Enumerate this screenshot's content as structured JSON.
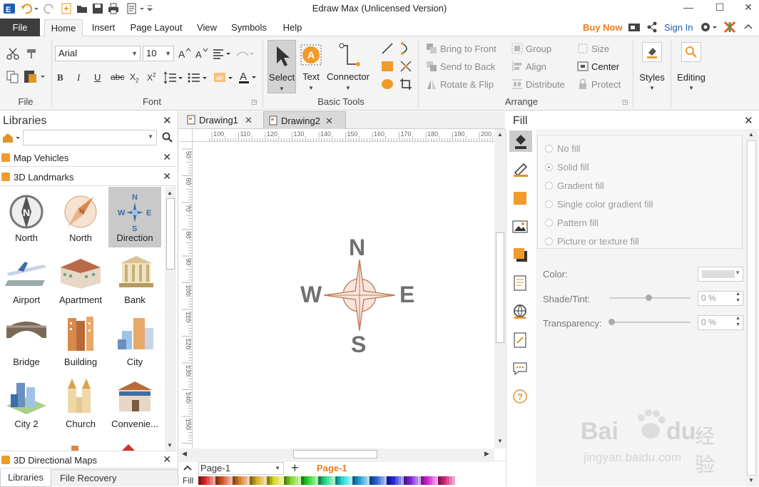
{
  "window": {
    "title": "Edraw Max (Unlicensed Version)"
  },
  "ribbon_tabs": {
    "file": "File",
    "tabs": [
      "Home",
      "Insert",
      "Page Layout",
      "View",
      "Symbols",
      "Help"
    ],
    "active": "Home",
    "buy_now": "Buy Now",
    "sign_in": "Sign In"
  },
  "ribbon": {
    "groups": {
      "file": "File",
      "font": "Font",
      "basic_tools": "Basic Tools",
      "arrange": "Arrange"
    },
    "font_name": "Arial",
    "font_size": "10",
    "tools": {
      "select": "Select",
      "text": "Text",
      "connector": "Connector"
    },
    "arrange": {
      "bring_to_front": "Bring to Front",
      "send_to_back": "Send to Back",
      "rotate_flip": "Rotate & Flip",
      "group": "Group",
      "align": "Align",
      "distribute": "Distribute",
      "size": "Size",
      "center": "Center",
      "protect": "Protect"
    },
    "styles": "Styles",
    "editing": "Editing"
  },
  "libraries": {
    "title": "Libraries",
    "search_value": "",
    "sections": [
      "Map Vehicles",
      "3D Landmarks"
    ],
    "shapes": [
      {
        "label": "North"
      },
      {
        "label": "North"
      },
      {
        "label": "Direction"
      },
      {
        "label": "Airport"
      },
      {
        "label": "Apartment"
      },
      {
        "label": "Bank"
      },
      {
        "label": "Bridge"
      },
      {
        "label": "Building"
      },
      {
        "label": "City"
      },
      {
        "label": "City 2"
      },
      {
        "label": "Church"
      },
      {
        "label": "Convenie..."
      }
    ],
    "bottom_section": "3D Directional Maps",
    "bottom_tabs": [
      "Libraries",
      "File Recovery"
    ]
  },
  "documents": {
    "tabs": [
      "Drawing1",
      "Drawing2"
    ],
    "active": "Drawing2"
  },
  "ruler": {
    "h_ticks": [
      "100",
      "110",
      "120",
      "130",
      "140",
      "150",
      "160",
      "170",
      "180",
      "190",
      "200"
    ],
    "v_ticks": [
      "50",
      "60",
      "70",
      "80",
      "90",
      "100",
      "110",
      "120",
      "130",
      "140",
      "150"
    ]
  },
  "compass": {
    "n": "N",
    "s": "S",
    "e": "E",
    "w": "W"
  },
  "pages": {
    "selector": "Page-1",
    "tab": "Page-1",
    "fill_label": "Fill"
  },
  "fill_panel": {
    "title": "Fill",
    "options": [
      "No fill",
      "Solid fill",
      "Gradient fill",
      "Single color gradient fill",
      "Pattern fill",
      "Picture or texture fill"
    ],
    "selected": "Solid fill",
    "color_label": "Color:",
    "shade_label": "Shade/Tint:",
    "shade_value": "0 %",
    "transparency_label": "Transparency:",
    "transparency_value": "0 %"
  },
  "watermark": {
    "brand": "Bai",
    "brand2": "du",
    "cn": "经验",
    "url": "jingyan.baidu.com"
  },
  "colors": {
    "accent": "#ea7e22",
    "file_tab": "#3d3d3d",
    "link": "#1e5fb4",
    "compass_fill": "#f7e6dc",
    "compass_stroke": "#c17a5a"
  }
}
